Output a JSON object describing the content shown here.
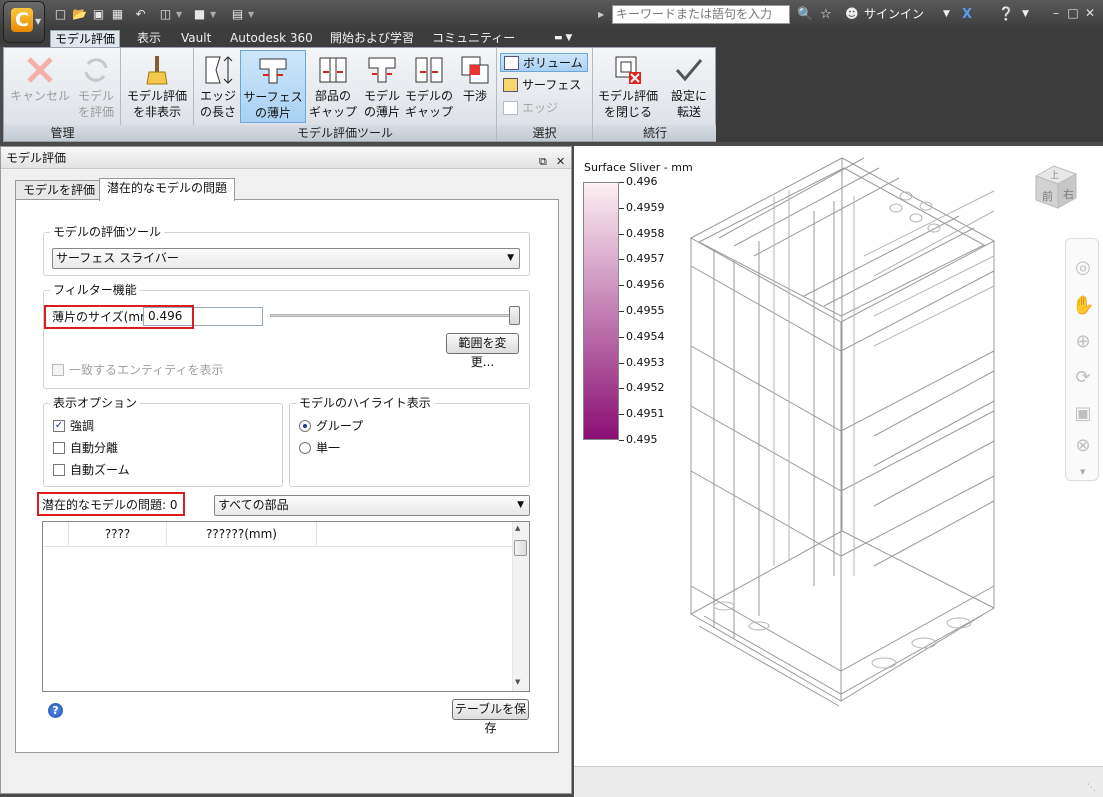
{
  "qat": {
    "icons": [
      "new-icon",
      "open-icon",
      "save-icon",
      "save-as-icon",
      "project-icon",
      "material-icon",
      "parameters-icon"
    ]
  },
  "titlebar": {
    "search_placeholder": "キーワードまたは語句を入力",
    "signin": "サインイン"
  },
  "ribbon_tabs": [
    {
      "label": "モデル評価",
      "active": true
    },
    {
      "label": "表示"
    },
    {
      "label": "Vault"
    },
    {
      "label": "Autodesk 360"
    },
    {
      "label": "開始および学習"
    },
    {
      "label": "コミュニティー"
    }
  ],
  "ribbon": {
    "groups": {
      "manage": "管理",
      "tools": "モデル評価ツール",
      "select": "選択",
      "continue": "続行"
    },
    "buttons": {
      "cancel": "キャンセル",
      "model_eval_1": "モデル",
      "model_eval_2": "を評価",
      "hide_1": "モデル評価",
      "hide_2": "を非表示",
      "edge_1": "エッジ",
      "edge_2": "の長さ",
      "surface_1": "サーフェス",
      "surface_2": "の薄片",
      "partgap_1": "部品の",
      "partgap_2": "ギャップ",
      "modelsliver_1": "モデル",
      "modelsliver_2": "の薄片",
      "modelgap_1": "モデルの",
      "modelgap_2": "ギャップ",
      "interference": "干渉",
      "volume": "ボリューム",
      "surface": "サーフェス",
      "edge": "エッジ",
      "close_1": "モデル評価",
      "close_2": "を閉じる",
      "forward_1": "設定に",
      "forward_2": "転送"
    }
  },
  "panel": {
    "title": "モデル評価",
    "tabs": [
      {
        "label": "モデルを評価"
      },
      {
        "label": "潜在的なモデルの問題",
        "active": true
      }
    ],
    "eval_tool": {
      "title": "モデルの評価ツール",
      "value": "サーフェス スライバー"
    },
    "filter": {
      "title": "フィルター機能",
      "size_label": "薄片のサイズ(mm)",
      "size_value": "0.496",
      "range_button": "範囲を変更...",
      "match_checkbox": "一致するエンティティを表示",
      "slider_fraction": 1.0
    },
    "display": {
      "title": "表示オプション",
      "highlight": "強調",
      "auto_isolate": "自動分離",
      "auto_zoom": "自動ズーム"
    },
    "highlight_mode": {
      "title": "モデルのハイライト表示",
      "group": "グループ",
      "single": "単一"
    },
    "issues": {
      "label": "潜在的なモデルの問題:",
      "count": "0",
      "scope": "すべての部品"
    },
    "table": {
      "columns": [
        "",
        "????",
        "??????(mm)",
        ""
      ]
    },
    "save_table": "テーブルを保存"
  },
  "legend": {
    "title": "Surface Sliver - mm",
    "ticks": [
      "0.496",
      "0.4959",
      "0.4958",
      "0.4957",
      "0.4956",
      "0.4955",
      "0.4954",
      "0.4953",
      "0.4952",
      "0.4951",
      "0.495"
    ],
    "color_top": "#fdf0f3",
    "color_bottom": "#8a0f74"
  },
  "viewcube": {
    "top": "上",
    "front": "前",
    "right": "右"
  }
}
